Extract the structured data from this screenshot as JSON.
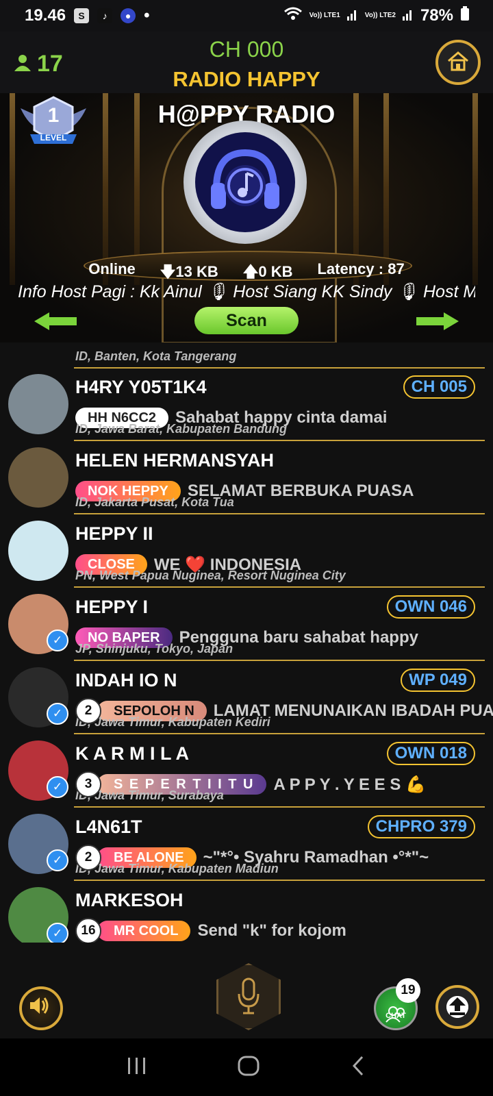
{
  "status_bar": {
    "time": "19.46",
    "carrier1": "Vo)) LTE1",
    "carrier2": "Vo)) LTE2",
    "battery": "78%"
  },
  "header": {
    "listener_count": "17",
    "channel": "CH 000",
    "radio_name": "RADIO HAPPY",
    "station_name": "H@PPY RADIO",
    "level_label": "LEVEL",
    "level_number": "1"
  },
  "stats": {
    "online_label": "Online",
    "download": "13 KB",
    "upload": "0 KB",
    "latency_label": "Latency :",
    "latency_value": "87"
  },
  "marquee_text": "Info Host Pagi : Kk Ainul 🎙 Host Siang KK Sindy 🎙 Host Ma",
  "scan_label": "Scan",
  "partial_row_location": "ID, Banten, Kota Tangerang",
  "users": [
    {
      "name": "H4RY  Y05T1K4",
      "channel_tag": "CH 005",
      "level": "",
      "badge": "HH  N6CC2",
      "badge_style": "white",
      "message": "Sahabat happy cinta damai",
      "location": "ID, Jawa Barat, Kabupaten Bandung",
      "verified": false,
      "avatar_color": "#7d8a93"
    },
    {
      "name": "HELEN HERMANSYAH",
      "channel_tag": "",
      "level": "",
      "badge": "NOK HEPPY",
      "badge_style": "pinkorange",
      "message": "SELAMAT BERBUKA PUASA",
      "location": "ID, Jakarta Pusat, Kota Tua",
      "verified": false,
      "avatar_color": "#6b5a3e"
    },
    {
      "name": "HEPPY II",
      "channel_tag": "",
      "level": "",
      "badge": "CLOSE",
      "badge_style": "pinkorange",
      "message": "WE ❤️ INDONESIA",
      "location": "PN, West Papua Nuginea, Resort Nuginea City",
      "verified": false,
      "avatar_color": "#cfe8f0"
    },
    {
      "name": "HEPPY I",
      "channel_tag": "OWN 046",
      "level": "",
      "badge": "NO BAPER",
      "badge_style": "purple",
      "message": "Pengguna baru sahabat happy",
      "location": "JP, Shinjuku, Tokyo, Japan",
      "verified": true,
      "avatar_color": "#c98b6c"
    },
    {
      "name": "INDAH IO N",
      "channel_tag": "WP 049",
      "level": "2",
      "badge": "SEPOLOH N",
      "badge_style": "peach",
      "message": "LAMAT MENUNAIKAN IBADAH PUASA",
      "location": "ID, Jawa Timur, Kabupaten Kediri",
      "verified": true,
      "avatar_color": "#2a2a2a"
    },
    {
      "name": "K A R M I L A",
      "channel_tag": "OWN 018",
      "level": "3",
      "badge": "S E P E R T I  I T U",
      "badge_style": "peachpurple",
      "message": "A P P Y  . Y E E S 💪",
      "location": "ID, Jawa Timur, Surabaya",
      "verified": true,
      "avatar_color": "#b8323a"
    },
    {
      "name": "L4N61T",
      "channel_tag": "CHPRO 379",
      "level": "2",
      "badge": "BE ALONE",
      "badge_style": "pinkorange",
      "message": "~\"*°• Syahru Ramadhan •°*\"~",
      "location": "ID, Jawa Timur, Kabupaten Madiun",
      "verified": true,
      "avatar_color": "#5a6f8e"
    },
    {
      "name": "MARKESOH",
      "channel_tag": "",
      "level": "16",
      "badge": "MR COOL",
      "badge_style": "pinkorange",
      "message": "Send \"k\" for kojom",
      "location": "",
      "verified": true,
      "avatar_color": "#4f8a43"
    }
  ],
  "chat_label": "CHAT",
  "chat_badge": "19",
  "colors": {
    "accent_green": "#8bd34a",
    "accent_gold": "#f5c431",
    "tag_blue": "#5fb0ff"
  }
}
